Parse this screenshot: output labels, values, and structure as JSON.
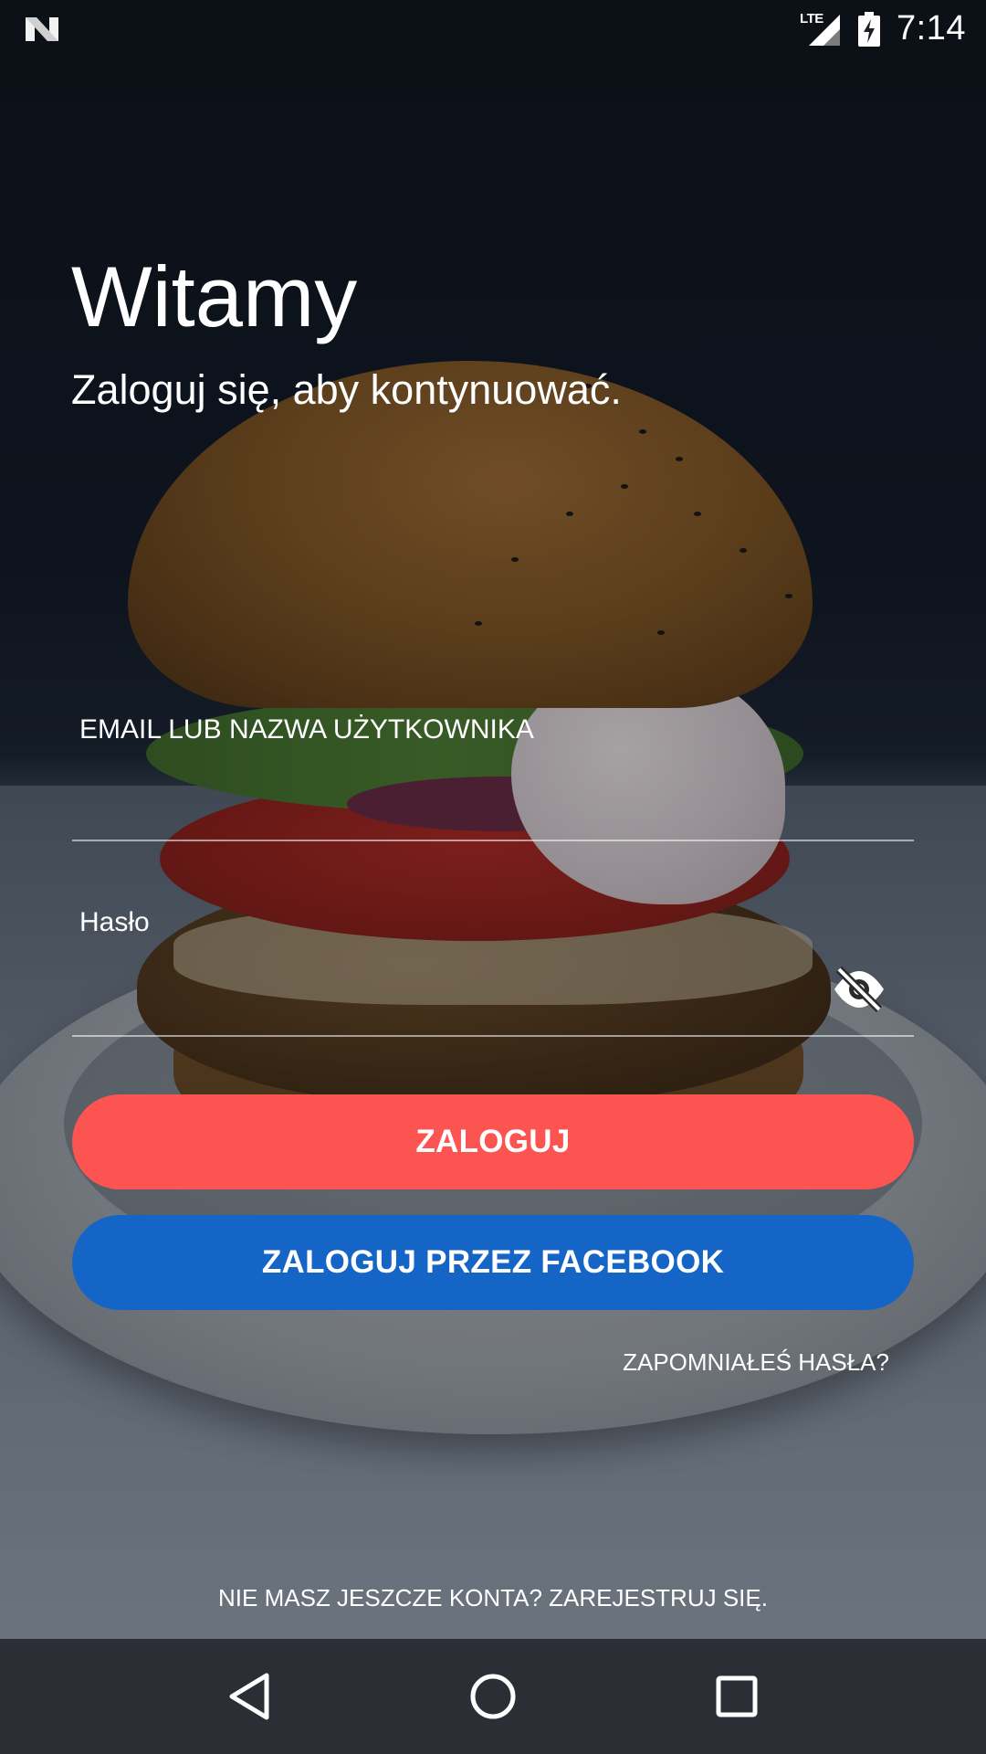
{
  "status_bar": {
    "network": "LTE",
    "time": "7:14"
  },
  "welcome": {
    "title": "Witamy",
    "subtitle": "Zaloguj się, aby kontynuować."
  },
  "form": {
    "email_label": "EMAIL LUB NAZWA UŻYTKOWNIKA",
    "password_label": "Hasło"
  },
  "buttons": {
    "login": "ZALOGUJ",
    "facebook": "ZALOGUJ PRZEZ FACEBOOK",
    "forgot_password": "ZAPOMNIAŁEŚ HASŁA?",
    "register": "NIE MASZ JESZCZE KONTA? ZAREJESTRUJ SIĘ."
  },
  "colors": {
    "login_button": "#fb5451",
    "facebook_button": "#1565c6",
    "nav_bar": "#2b2f35"
  },
  "icons": {
    "notification": "n-logo-icon",
    "signal": "signal-icon",
    "battery": "battery-charging-icon",
    "password_toggle": "eye-off-icon",
    "nav_back": "back-triangle-icon",
    "nav_home": "home-circle-icon",
    "nav_recents": "recents-square-icon"
  }
}
